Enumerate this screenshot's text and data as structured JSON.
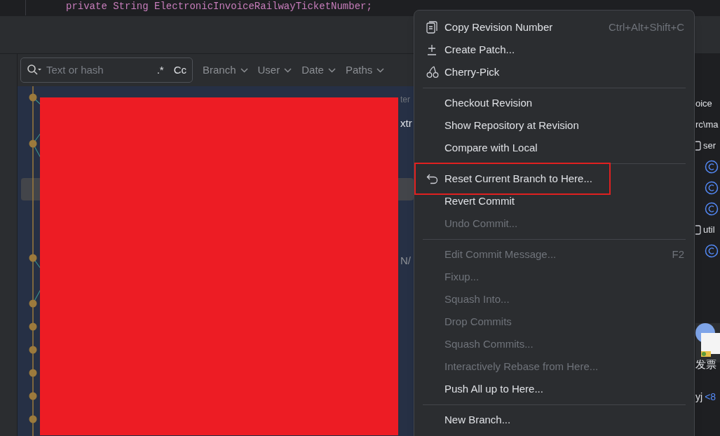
{
  "editor": {
    "code_line": "private String ElectronicInvoiceRailwayTicketNumber;"
  },
  "log_toolbar": {
    "search": {
      "placeholder": "Text or hash"
    },
    "regex_toggle": ".*",
    "case_toggle": "Cc",
    "filters": [
      "Branch",
      "User",
      "Date",
      "Paths"
    ]
  },
  "commit_log": {
    "fragments": [
      {
        "kind": "ref",
        "text": "ter"
      },
      {
        "kind": "message",
        "text": "xtr"
      },
      {
        "kind": "message",
        "text": "N/"
      }
    ]
  },
  "context_menu": {
    "groups": [
      [
        {
          "label": "Copy Revision Number",
          "shortcut": "Ctrl+Alt+Shift+C",
          "kind": "copy",
          "disabled": false
        },
        {
          "label": "Create Patch...",
          "kind": "patch",
          "disabled": false
        },
        {
          "label": "Cherry-Pick",
          "kind": "cherry",
          "disabled": false
        }
      ],
      [
        {
          "label": "Checkout Revision",
          "disabled": false
        },
        {
          "label": "Show Repository at Revision",
          "disabled": false
        },
        {
          "label": "Compare with Local",
          "disabled": false
        }
      ],
      [
        {
          "label": "Reset Current Branch to Here...",
          "kind": "undo",
          "disabled": false
        },
        {
          "label": "Revert Commit",
          "disabled": false
        },
        {
          "label": "Undo Commit...",
          "disabled": true
        }
      ],
      [
        {
          "label": "Edit Commit Message...",
          "shortcut": "F2",
          "disabled": true
        },
        {
          "label": "Fixup...",
          "disabled": true
        },
        {
          "label": "Squash Into...",
          "disabled": true
        },
        {
          "label": "Drop Commits",
          "disabled": true
        },
        {
          "label": "Squash Commits...",
          "disabled": true
        },
        {
          "label": "Interactively Rebase from Here...",
          "disabled": true
        },
        {
          "label": "Push All up to Here...",
          "disabled": false
        }
      ],
      [
        {
          "label": "New Branch...",
          "disabled": false
        }
      ]
    ]
  },
  "details_panel": {
    "lines": [
      {
        "kind": "text",
        "text": "oice"
      },
      {
        "kind": "text",
        "text": "rc\\ma"
      },
      {
        "kind": "folder",
        "text": "ser"
      },
      {
        "kind": "class"
      },
      {
        "kind": "class"
      },
      {
        "kind": "class"
      },
      {
        "kind": "folder",
        "text": "util"
      },
      {
        "kind": "class"
      }
    ],
    "caption": "发票",
    "author": "yj",
    "email": "<8"
  }
}
